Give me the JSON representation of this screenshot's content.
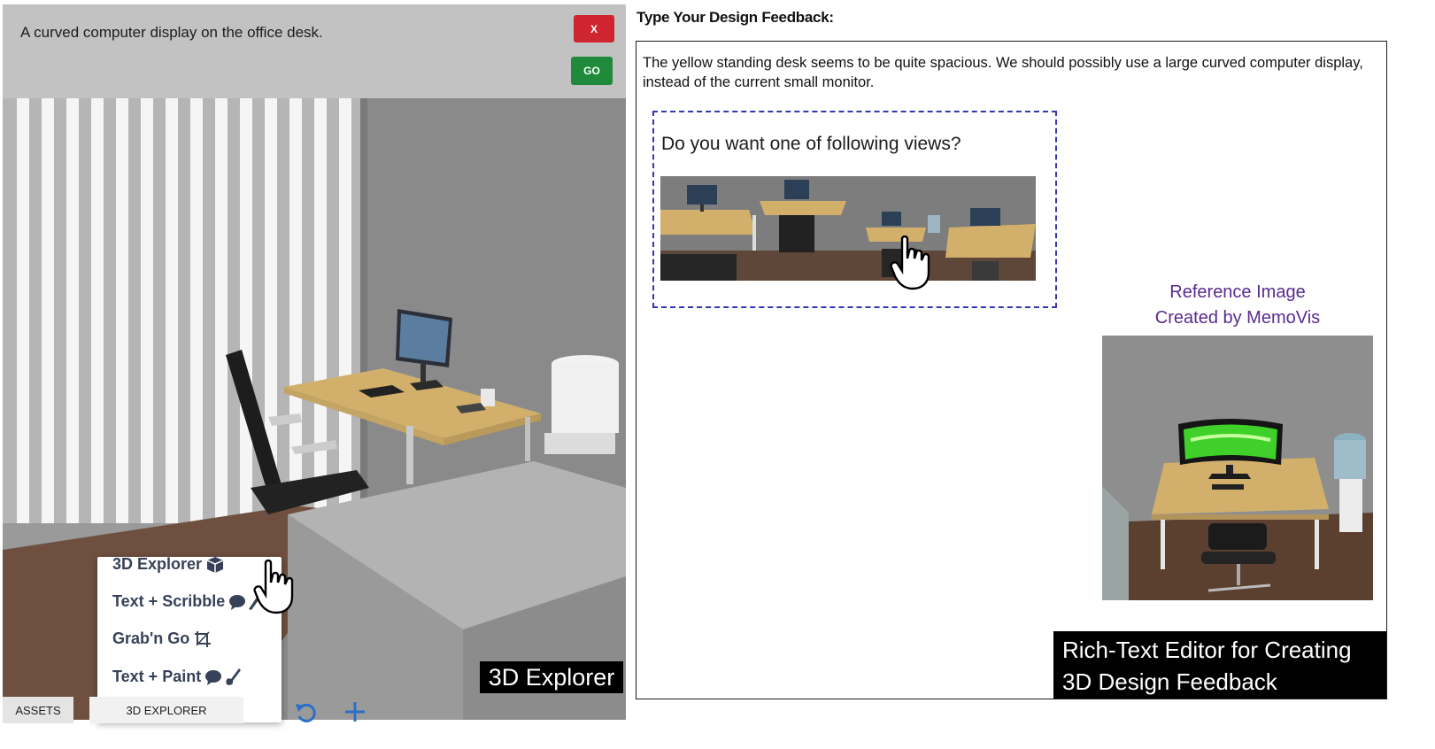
{
  "explorer": {
    "prompt_text": "A curved computer display on the office desk.",
    "close_label": "X",
    "go_label": "GO",
    "panel_label": "3D Explorer",
    "menu": [
      {
        "label": "3D Explorer",
        "icon": "cube-icon"
      },
      {
        "label": "Text + Scribble",
        "icon": "comment-brush-icon"
      },
      {
        "label": "Grab'n Go",
        "icon": "crop-icon"
      },
      {
        "label": "Text + Paint",
        "icon": "comment-paint-icon"
      }
    ]
  },
  "bottom_bar": {
    "assets_label": "ASSETS",
    "explorer_tab_label": "3D EXPLORER",
    "undo_icon": "undo-icon",
    "add_icon": "plus-icon"
  },
  "feedback": {
    "title": "Type Your Design Feedback:",
    "text": "The yellow standing desk seems to be quite spacious. We should possibly use a large curved computer display, instead of the current small monitor.",
    "views_question": "Do you want one of following views?",
    "reference_caption_line1": "Reference Image",
    "reference_caption_line2": "Created by MemoVis",
    "editor_label_line1": "Rich-Text Editor for Creating",
    "editor_label_line2": "3D Design Feedback"
  },
  "colors": {
    "close_button": "#cf2530",
    "go_button": "#1e8a3a",
    "dashed_border": "#3636b3",
    "reference_caption": "#5a2a8f",
    "menu_text": "#374258",
    "desk_top": "#d2b06b"
  }
}
